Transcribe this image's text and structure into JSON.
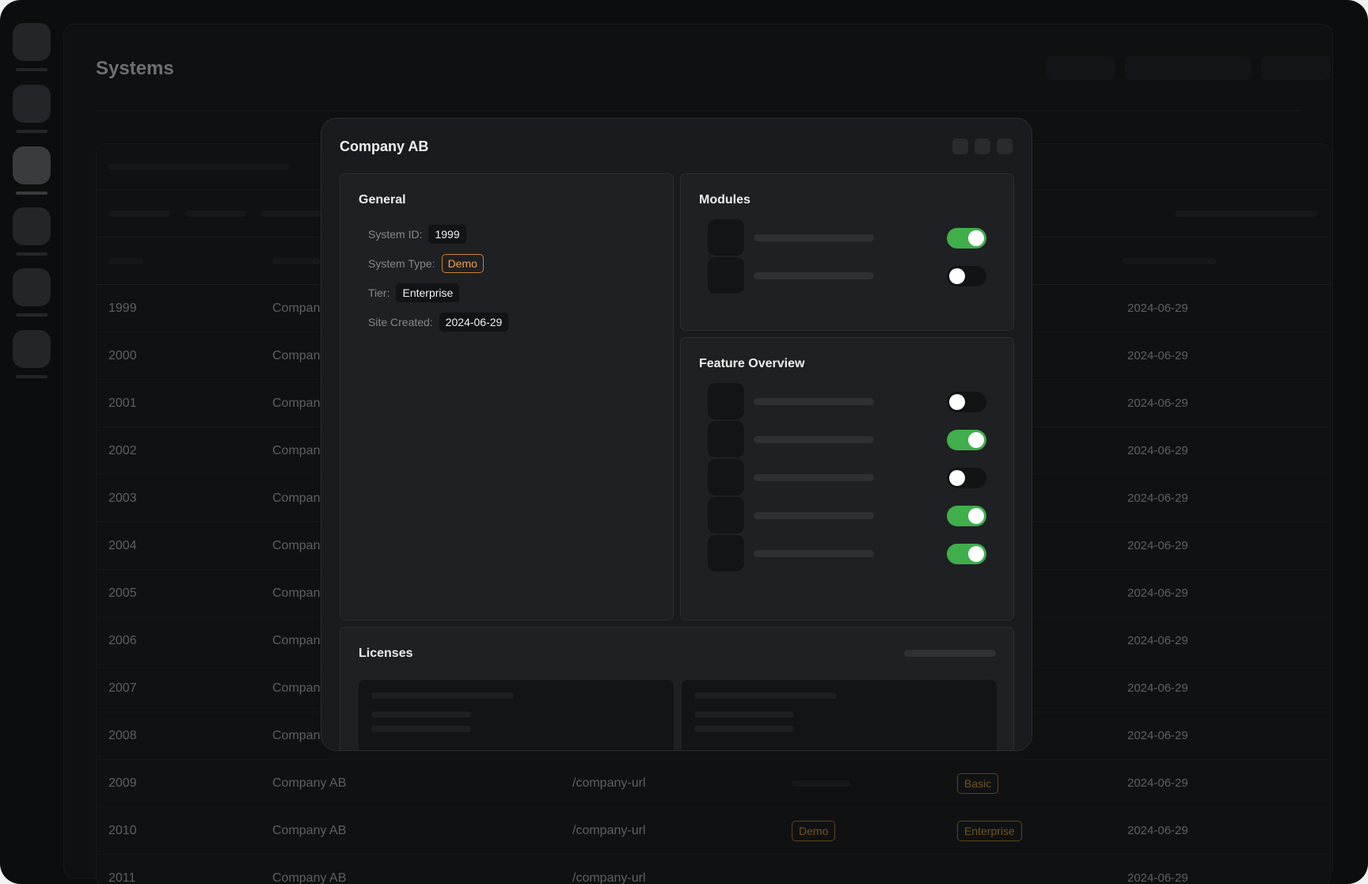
{
  "page": {
    "title": "Systems"
  },
  "table": {
    "rows": [
      {
        "id": "1999",
        "name": "Compan",
        "date": "2024-06-29"
      },
      {
        "id": "2000",
        "name": "Compan",
        "date": "2024-06-29"
      },
      {
        "id": "2001",
        "name": "Compan",
        "date": "2024-06-29"
      },
      {
        "id": "2002",
        "name": "Compan",
        "date": "2024-06-29"
      },
      {
        "id": "2003",
        "name": "Compan",
        "date": "2024-06-29"
      },
      {
        "id": "2004",
        "name": "Compan",
        "date": "2024-06-29"
      },
      {
        "id": "2005",
        "name": "Compan",
        "date": "2024-06-29"
      },
      {
        "id": "2006",
        "name": "Compan",
        "date": "2024-06-29"
      },
      {
        "id": "2007",
        "name": "Compan",
        "date": "2024-06-29"
      },
      {
        "id": "2008",
        "name": "Compan",
        "date": "2024-06-29"
      },
      {
        "id": "2009",
        "name": "Company AB",
        "url": "/company-url",
        "tier": "Basic",
        "date": "2024-06-29"
      },
      {
        "id": "2010",
        "name": "Company AB",
        "url": "/company-url",
        "type": "Demo",
        "tier": "Enterprise",
        "date": "2024-06-29"
      },
      {
        "id": "2011",
        "name": "Company AB",
        "url": "/company-url",
        "date": "2024-06-29"
      }
    ]
  },
  "modal": {
    "title": "Company AB",
    "general": {
      "title": "General",
      "system_id_label": "System ID:",
      "system_id": "1999",
      "system_type_label": "System Type:",
      "system_type": "Demo",
      "tier_label": "Tier:",
      "tier": "Enterprise",
      "site_created_label": "Site Created:",
      "site_created": "2024-06-29"
    },
    "modules": {
      "title": "Modules",
      "toggles": [
        true,
        false
      ]
    },
    "features": {
      "title": "Feature Overview",
      "toggles": [
        false,
        true,
        false,
        true,
        true
      ]
    },
    "licenses": {
      "title": "Licenses"
    }
  },
  "colors": {
    "accent_green": "#3fae4b",
    "badge_orange": "#e9a34a",
    "background": "#0c0d0f"
  }
}
